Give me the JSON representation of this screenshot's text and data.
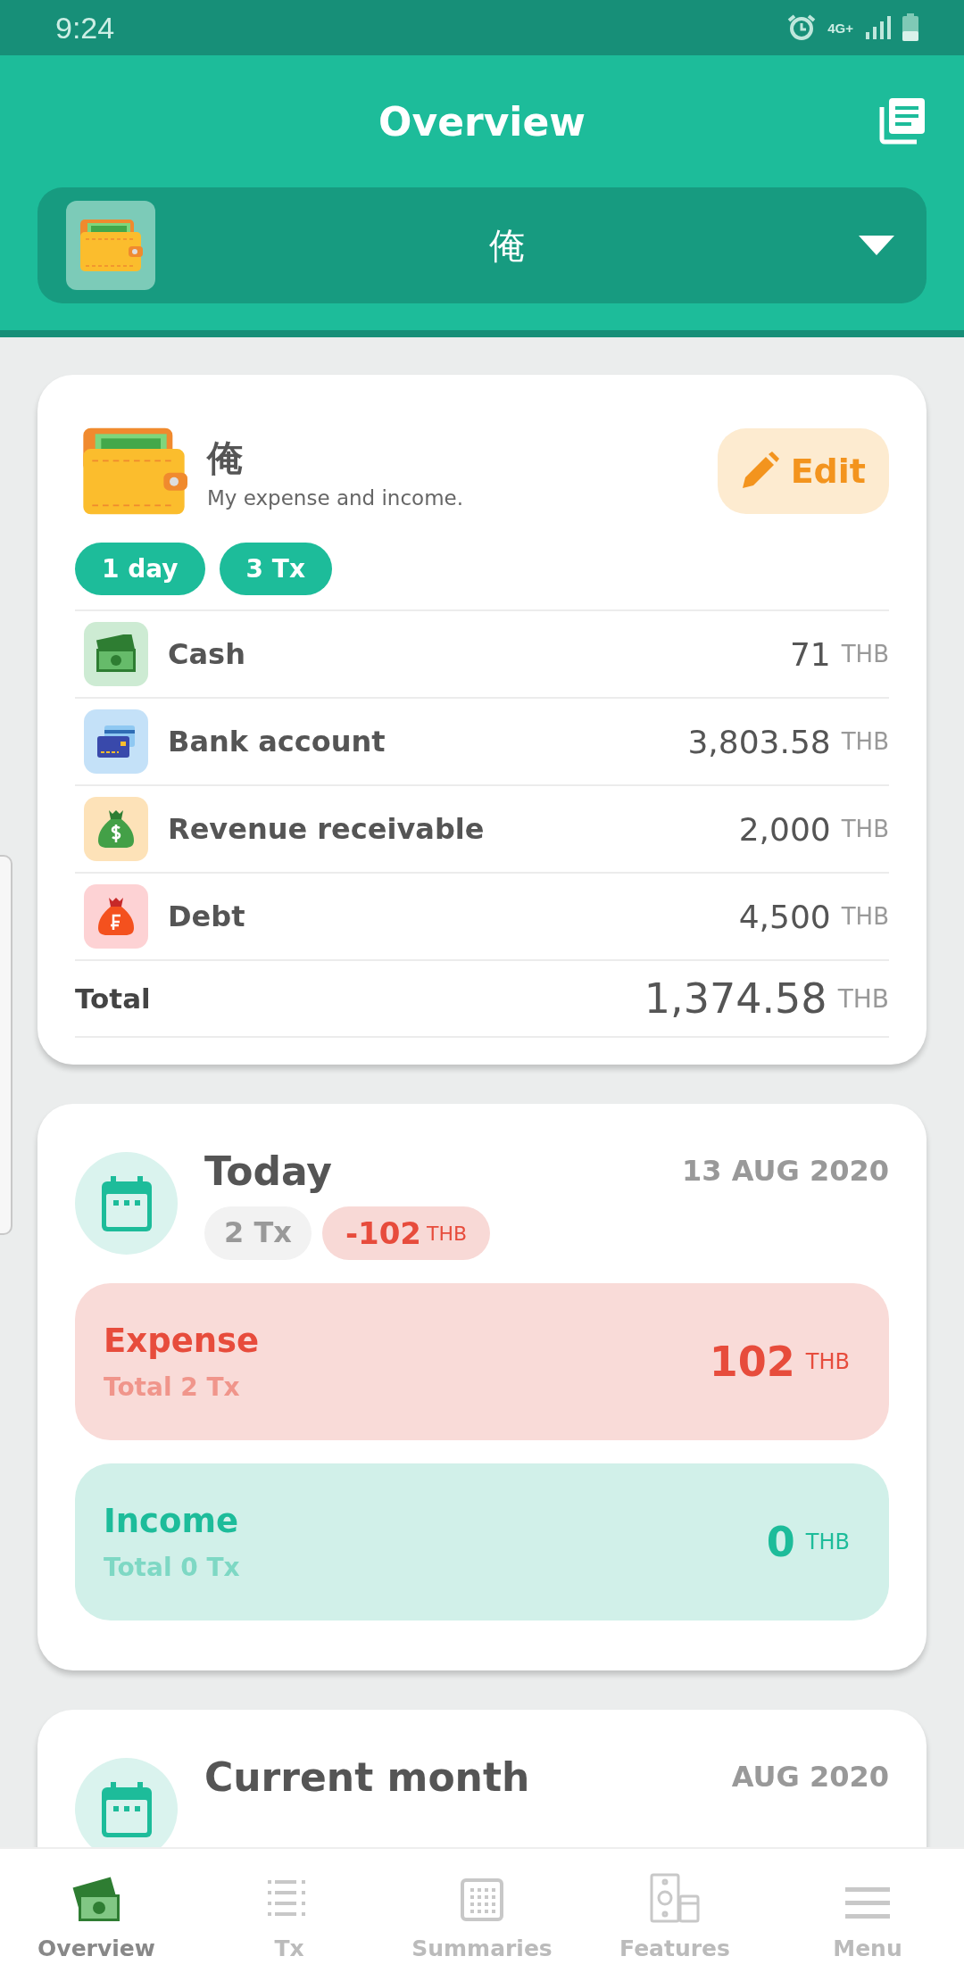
{
  "status_bar": {
    "time": "9:24",
    "network": "4G+"
  },
  "header": {
    "title": "Overview",
    "wallet_selector": {
      "name": "俺"
    }
  },
  "wallet_card": {
    "name": "俺",
    "description": "My expense and income.",
    "edit_label": "Edit",
    "chips": [
      "1 day",
      "3 Tx"
    ],
    "accounts": [
      {
        "kind": "cash",
        "name": "Cash",
        "amount": "71",
        "currency": "THB"
      },
      {
        "kind": "bank",
        "name": "Bank account",
        "amount": "3,803.58",
        "currency": "THB"
      },
      {
        "kind": "receivable",
        "name": "Revenue receivable",
        "amount": "2,000",
        "currency": "THB"
      },
      {
        "kind": "debt",
        "name": "Debt",
        "amount": "4,500",
        "currency": "THB"
      }
    ],
    "total": {
      "label": "Total",
      "amount": "1,374.58",
      "currency": "THB"
    }
  },
  "periods": [
    {
      "title": "Today",
      "date": "13 AUG 2020",
      "tx_count": "2 Tx",
      "net": "-102",
      "net_currency": "THB",
      "summaries": [
        {
          "kind": "expense",
          "label": "Expense",
          "subtitle": "Total 2 Tx",
          "amount": "102",
          "currency": "THB"
        },
        {
          "kind": "income",
          "label": "Income",
          "subtitle": "Total 0 Tx",
          "amount": "0",
          "currency": "THB"
        }
      ]
    },
    {
      "title": "Current month",
      "date": "AUG 2020"
    }
  ],
  "bottom_nav": [
    {
      "kind": "cash",
      "label": "Overview",
      "selected": true
    },
    {
      "kind": "list",
      "label": "Tx",
      "selected": false
    },
    {
      "kind": "grid",
      "label": "Summaries",
      "selected": false
    },
    {
      "kind": "features",
      "label": "Features",
      "selected": false
    },
    {
      "kind": "menu",
      "label": "Menu",
      "selected": false
    }
  ]
}
